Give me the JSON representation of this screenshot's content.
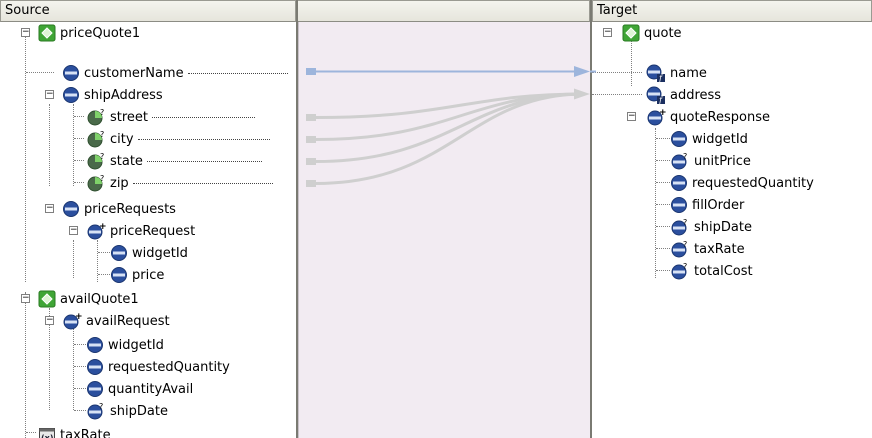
{
  "source": {
    "title": "Source",
    "nodes": [
      {
        "label": "priceQuote1",
        "icon": "schema-root-icon"
      },
      {
        "label": "customerName",
        "icon": "element-icon"
      },
      {
        "label": "shipAddress",
        "icon": "element-icon"
      },
      {
        "label": "street",
        "icon": "optional-attribute-icon"
      },
      {
        "label": "city",
        "icon": "optional-attribute-icon"
      },
      {
        "label": "state",
        "icon": "optional-attribute-icon"
      },
      {
        "label": "zip",
        "icon": "optional-attribute-icon"
      },
      {
        "label": "priceRequests",
        "icon": "element-icon"
      },
      {
        "label": "priceRequest",
        "icon": "repeating-element-icon"
      },
      {
        "label": "widgetId",
        "icon": "element-icon"
      },
      {
        "label": "price",
        "icon": "element-icon"
      },
      {
        "label": "availQuote1",
        "icon": "schema-root-icon"
      },
      {
        "label": "availRequest",
        "icon": "repeating-element-icon"
      },
      {
        "label": "widgetId",
        "icon": "element-icon"
      },
      {
        "label": "requestedQuantity",
        "icon": "element-icon"
      },
      {
        "label": "quantityAvail",
        "icon": "element-icon"
      },
      {
        "label": "shipDate",
        "icon": "optional-element-icon"
      },
      {
        "label": "taxRate",
        "icon": "variable-icon"
      }
    ]
  },
  "mapper": {
    "title": ""
  },
  "target": {
    "title": "Target",
    "nodes": [
      {
        "label": "quote",
        "icon": "schema-root-icon"
      },
      {
        "label": "name",
        "icon": "function-element-icon"
      },
      {
        "label": "address",
        "icon": "function-element-icon"
      },
      {
        "label": "quoteResponse",
        "icon": "repeating-element-icon"
      },
      {
        "label": "widgetId",
        "icon": "element-icon"
      },
      {
        "label": "unitPrice",
        "icon": "optional-element-icon"
      },
      {
        "label": "requestedQuantity",
        "icon": "element-icon"
      },
      {
        "label": "fillOrder",
        "icon": "element-icon"
      },
      {
        "label": "shipDate",
        "icon": "optional-element-icon"
      },
      {
        "label": "taxRate",
        "icon": "optional-element-icon"
      },
      {
        "label": "totalCost",
        "icon": "optional-element-icon"
      }
    ]
  },
  "colors": {
    "mapped_link": "#9db5dc",
    "unmapped_link": "#cfcfcf",
    "mapper_background": "#f2ebf2",
    "root_icon": "#3fa535",
    "element_icon": "#2b4f9e"
  }
}
